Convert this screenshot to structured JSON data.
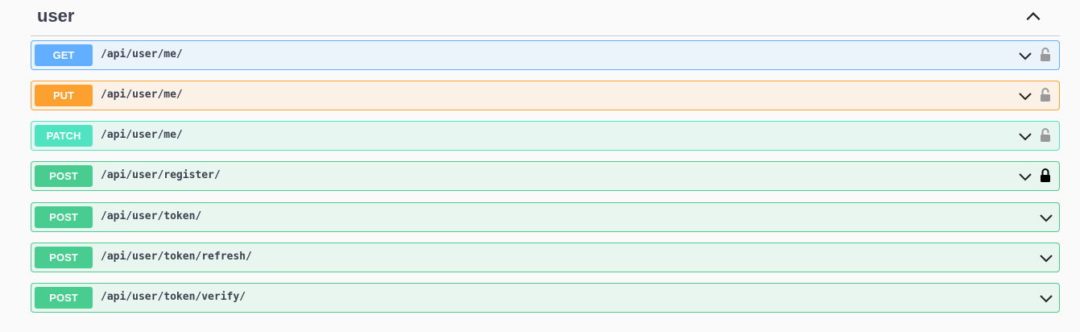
{
  "section": {
    "title": "user"
  },
  "operations": [
    {
      "method": "GET",
      "path": "/api/user/me/",
      "lock": "unlocked"
    },
    {
      "method": "PUT",
      "path": "/api/user/me/",
      "lock": "unlocked"
    },
    {
      "method": "PATCH",
      "path": "/api/user/me/",
      "lock": "unlocked"
    },
    {
      "method": "POST",
      "path": "/api/user/register/",
      "lock": "locked"
    },
    {
      "method": "POST",
      "path": "/api/user/token/",
      "lock": "none"
    },
    {
      "method": "POST",
      "path": "/api/user/token/refresh/",
      "lock": "none"
    },
    {
      "method": "POST",
      "path": "/api/user/token/verify/",
      "lock": "none"
    }
  ],
  "colors": {
    "get": "#61affe",
    "put": "#fca130",
    "patch": "#50e3c2",
    "post": "#49cc90",
    "text": "#3b4151"
  },
  "icons": {
    "collapse": "chevron-up-icon",
    "expand": "chevron-down-icon",
    "auth": "padlock-icon"
  }
}
